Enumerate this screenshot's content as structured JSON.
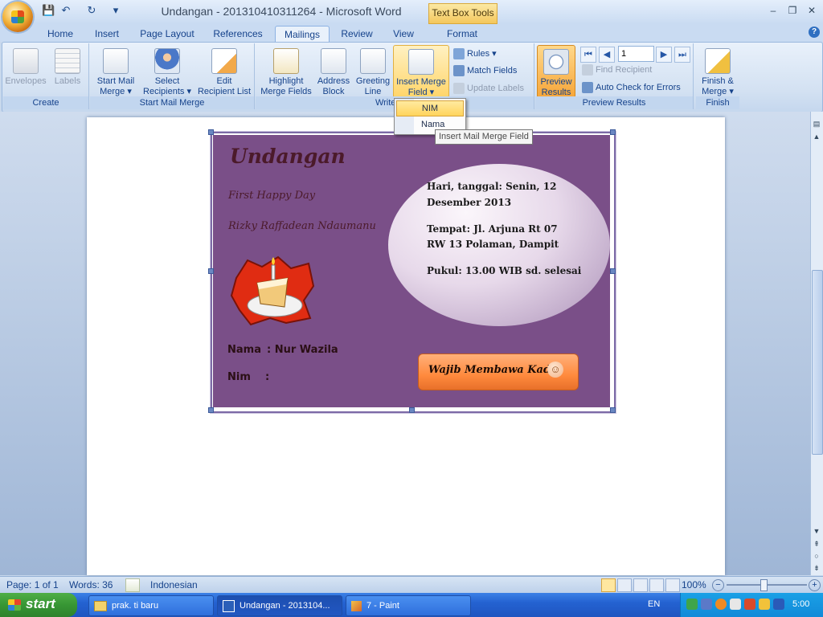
{
  "window": {
    "title": "Undangan - 201310410311264 - Microsoft Word",
    "context_tab": "Text Box Tools",
    "controls": {
      "minimize": "–",
      "restore": "❐",
      "close": "✕"
    }
  },
  "qat": {
    "save": "💾",
    "undo": "↶",
    "redo": "↻",
    "more": "▾"
  },
  "tabs": [
    "Home",
    "Insert",
    "Page Layout",
    "References",
    "Mailings",
    "Review",
    "View",
    "Format"
  ],
  "active_tab": "Mailings",
  "help": "?",
  "ribbon": {
    "create": {
      "caption": "Create",
      "envelopes": "Envelopes",
      "labels": "Labels"
    },
    "start": {
      "caption": "Start Mail Merge",
      "start_l1": "Start Mail",
      "start_l2": "Merge ▾",
      "select_l1": "Select",
      "select_l2": "Recipients ▾",
      "edit_l1": "Edit",
      "edit_l2": "Recipient List"
    },
    "write": {
      "caption": "Write & Insert Fields",
      "caption_visible": "Write & In",
      "highlight_l1": "Highlight",
      "highlight_l2": "Merge Fields",
      "address_l1": "Address",
      "address_l2": "Block",
      "greeting_l1": "Greeting",
      "greeting_l2": "Line",
      "insert_l1": "Insert Merge",
      "insert_l2": "Field ▾",
      "rules": "Rules ▾",
      "match": "Match Fields",
      "update": "Update Labels"
    },
    "preview": {
      "caption": "Preview Results",
      "preview_l1": "Preview",
      "preview_l2": "Results",
      "first": "⏮",
      "prev": "◀",
      "record": "1",
      "next": "▶",
      "last": "⏭",
      "find": "Find Recipient",
      "autocheck": "Auto Check for Errors"
    },
    "finish": {
      "caption": "Finish",
      "finish_l1": "Finish &",
      "finish_l2": "Merge ▾"
    }
  },
  "dropdown": {
    "items": [
      "NIM",
      "Nama"
    ],
    "highlighted": "NIM",
    "tooltip": "Insert Mail Merge Field"
  },
  "card": {
    "title": "Undangan",
    "line1": "First Happy Day",
    "line2": "Rizky Raffadean Ndaumanu",
    "ellipse": {
      "p1a": "Hari, tanggal: Senin, 12",
      "p1b": "Desember 2013",
      "p2a": "Tempat: Jl. Arjuna Rt 07",
      "p2b": "RW 13 Polaman, Dampit",
      "p3": "Pukul: 13.00 WIB sd. selesai"
    },
    "nama_label": "Nama",
    "nama_value": ": Nur Wazila",
    "nim_label": "Nim",
    "nim_value": ":",
    "button": "Wajib Membawa Kado",
    "smiley": "☺"
  },
  "status": {
    "page": "Page: 1 of 1",
    "words": "Words: 36",
    "language": "Indonesian",
    "zoom": "100%"
  },
  "taskbar": {
    "start": "start",
    "tasks": [
      "prak. ti baru",
      "Undangan - 2013104...",
      "7 - Paint"
    ],
    "lang": "EN",
    "clock": "5:00"
  }
}
